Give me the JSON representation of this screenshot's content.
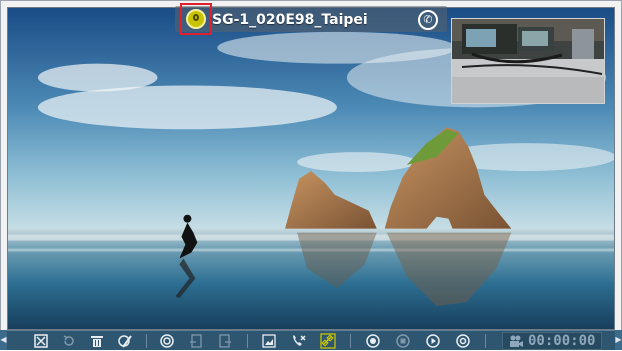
{
  "window": {
    "title": "SG-1_020E98_Taipei"
  },
  "toolbar": {
    "icons": [
      "close-view-icon",
      "rotate-icon",
      "delete-icon",
      "paint-icon",
      "target-icon",
      "export-left-icon",
      "export-right-icon",
      "snapshot-icon",
      "end-call-icon",
      "link-icon",
      "record-icon",
      "stop-icon",
      "play-icon",
      "settings-icon"
    ],
    "timer": "00:00:00"
  },
  "colors": {
    "toolbar_bg": "#2f5671",
    "highlight": "#e0202a",
    "active_icon": "#c7c300"
  }
}
